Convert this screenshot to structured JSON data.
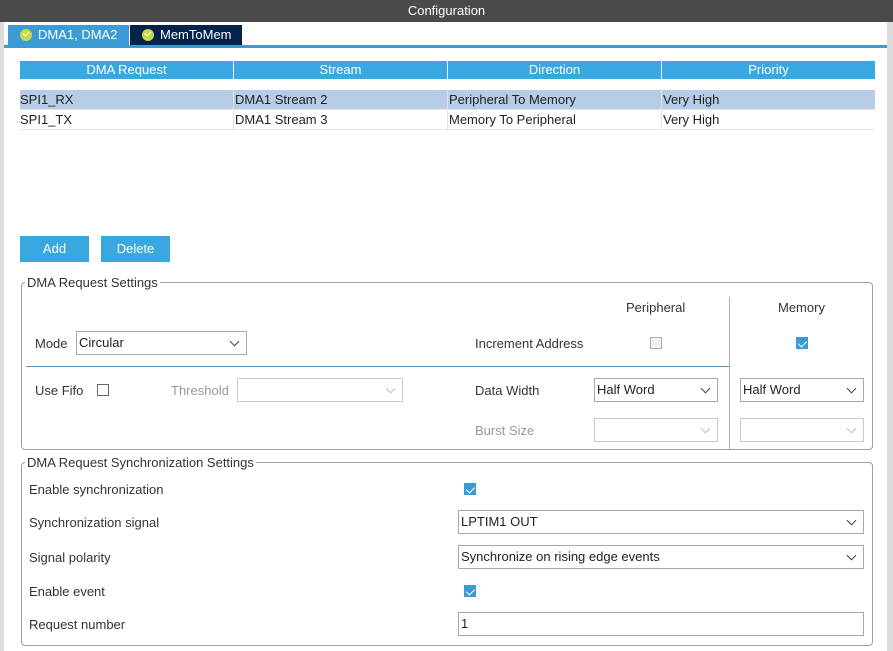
{
  "window": {
    "title": "Configuration"
  },
  "tabs": [
    {
      "label": "DMA1, DMA2",
      "active": true
    },
    {
      "label": "MemToMem",
      "active": false
    }
  ],
  "table": {
    "headers": [
      "DMA Request",
      "Stream",
      "Direction",
      "Priority"
    ],
    "rows": [
      {
        "request": "SPI1_RX",
        "stream": "DMA1 Stream 2",
        "direction": "Peripheral To Memory",
        "priority": "Very High",
        "selected": true
      },
      {
        "request": "SPI1_TX",
        "stream": "DMA1 Stream 3",
        "direction": "Memory To Peripheral",
        "priority": "Very High",
        "selected": false
      }
    ]
  },
  "buttons": {
    "add": "Add",
    "delete": "Delete"
  },
  "request_settings": {
    "legend": "DMA Request Settings",
    "peripheral_header": "Peripheral",
    "memory_header": "Memory",
    "mode_label": "Mode",
    "mode_value": "Circular",
    "increment_label": "Increment Address",
    "increment_peripheral": false,
    "increment_memory": true,
    "use_fifo_label": "Use Fifo",
    "use_fifo": false,
    "threshold_label": "Threshold",
    "threshold_value": "",
    "data_width_label": "Data Width",
    "data_width_peripheral": "Half Word",
    "data_width_memory": "Half Word",
    "burst_size_label": "Burst Size",
    "burst_peripheral": "",
    "burst_memory": ""
  },
  "sync_settings": {
    "legend": "DMA Request Synchronization Settings",
    "enable_sync_label": "Enable synchronization",
    "enable_sync": true,
    "sync_signal_label": "Synchronization signal",
    "sync_signal_value": "LPTIM1 OUT",
    "polarity_label": "Signal polarity",
    "polarity_value": "Synchronize on rising edge events",
    "enable_event_label": "Enable event",
    "enable_event": true,
    "request_number_label": "Request number",
    "request_number_value": "1"
  },
  "colors": {
    "accent": "#3a9bd5",
    "header_blue": "#3aa8e0",
    "tab_dark": "#03234b",
    "selected_row": "#b7cce6",
    "titlebar": "#4a4a4a"
  }
}
